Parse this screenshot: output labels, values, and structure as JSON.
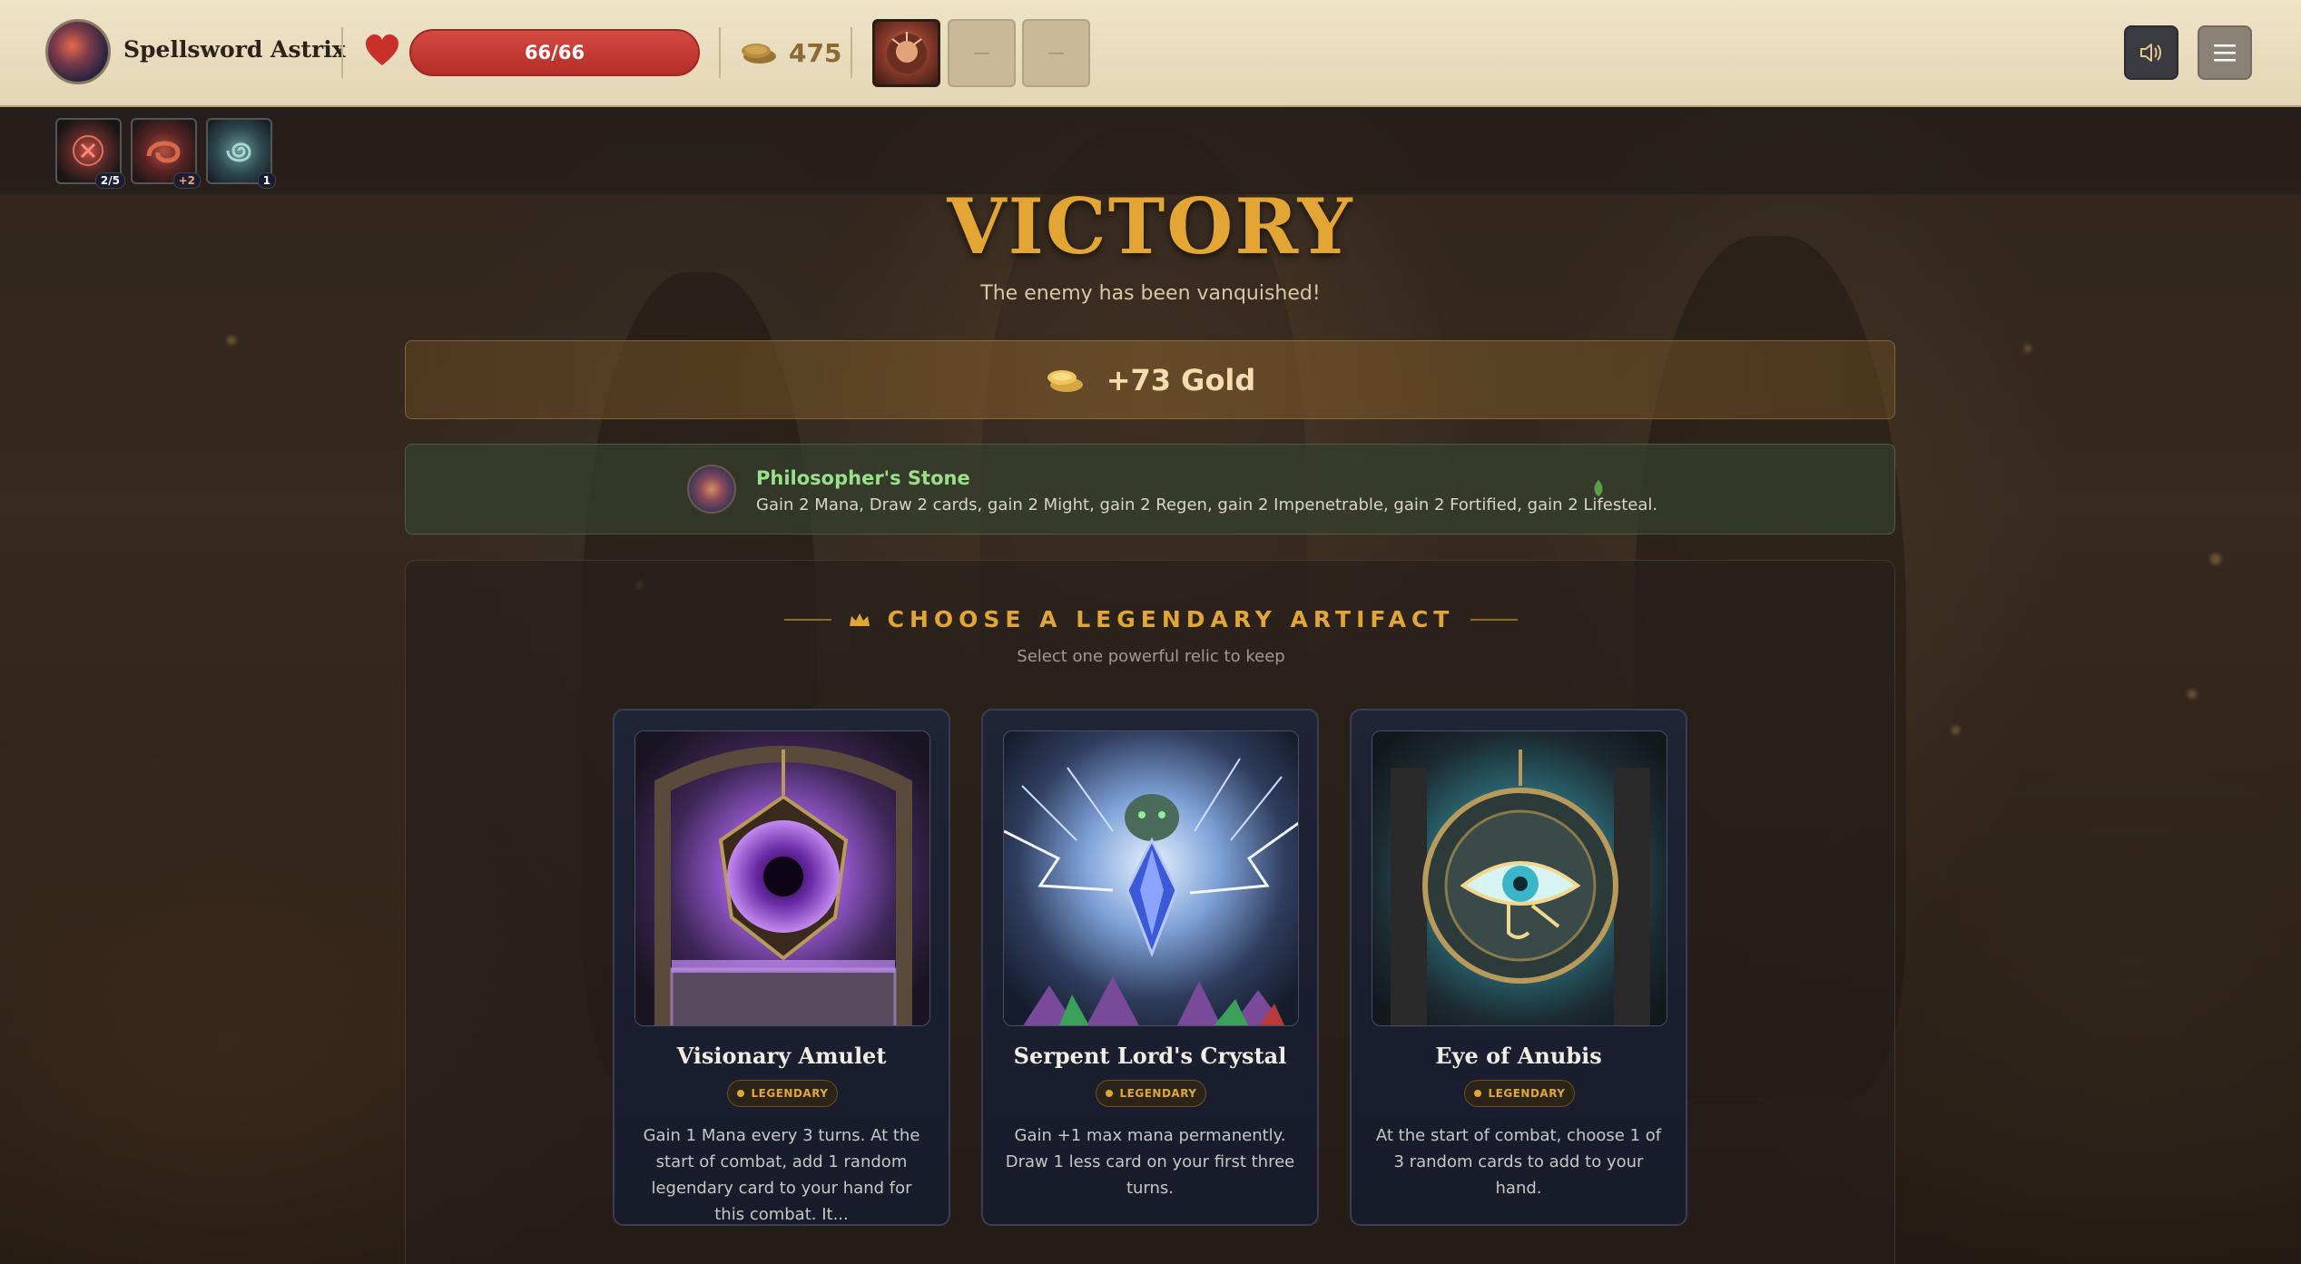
{
  "player": {
    "name": "Spellsword Astrix",
    "hp_text": "66/66",
    "hp_fraction": 1.0,
    "gold": "475"
  },
  "equipment_slots": [
    {
      "state": "filled",
      "icon": "relic-portrait"
    },
    {
      "state": "empty",
      "label": "—"
    },
    {
      "state": "empty",
      "label": "—"
    }
  ],
  "status_effects": [
    {
      "icon": "cursed-orb-icon",
      "badge": "2/5"
    },
    {
      "icon": "serpent-coil-icon",
      "badge": "+2"
    },
    {
      "icon": "spiral-rune-icon",
      "badge": "1"
    }
  ],
  "victory": {
    "title": "VICTORY",
    "subtitle": "The enemy has been vanquished!"
  },
  "rewards": {
    "gold_text": "+73 Gold",
    "relic": {
      "name": "Philosopher's Stone",
      "description": "Gain 2 Mana, Draw 2 cards, gain 2 Might, gain 2 Regen, gain 2 Impenetrable, gain 2 Fortified, gain 2 Lifesteal."
    }
  },
  "artifact_choice": {
    "title": "CHOOSE A LEGENDARY ARTIFACT",
    "subtitle": "Select one powerful relic to keep",
    "cards": [
      {
        "name": "Visionary Amulet",
        "rarity": "LEGENDARY",
        "description": "Gain 1 Mana every 3 turns. At the start of combat, add 1 random legendary card to your hand for this combat. It..."
      },
      {
        "name": "Serpent Lord's Crystal",
        "rarity": "LEGENDARY",
        "description": "Gain +1 max mana permanently. Draw 1 less card on your first three turns."
      },
      {
        "name": "Eye of Anubis",
        "rarity": "LEGENDARY",
        "description": "At the start of combat, choose 1 of 3 random cards to add to your hand."
      }
    ]
  },
  "colors": {
    "accent_gold": "#e3a635",
    "hp_red": "#c13a31",
    "relic_green": "#9ae08a",
    "topbar": "#eadcbd"
  }
}
